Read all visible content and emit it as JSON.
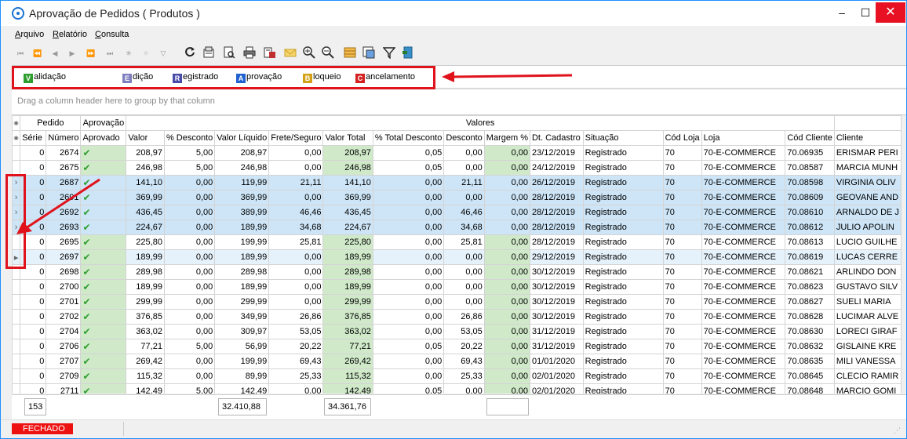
{
  "window": {
    "title": "Aprovação de Pedidos ( Produtos )",
    "min": "–",
    "max": "☐",
    "close": "✕"
  },
  "menu": [
    {
      "u": "A",
      "rest": "rquivo"
    },
    {
      "u": "R",
      "rest": "elatório"
    },
    {
      "u": "C",
      "rest": "onsulta"
    }
  ],
  "toolbar": {
    "nav": [
      "⏮",
      "⏪",
      "◀",
      "▶",
      "⏩",
      "⏭",
      "✳",
      "✳",
      "▽"
    ],
    "icons": [
      "refresh-icon",
      "properties-icon",
      "preview-icon",
      "print-icon",
      "export-icon",
      "email-icon",
      "zoom-in-icon",
      "zoom-out-icon",
      "columns-icon",
      "layout-icon",
      "filter-icon",
      "exit-icon"
    ]
  },
  "legend": [
    {
      "letter": "V",
      "rest": "alidação",
      "color": "#2e9e2e"
    },
    {
      "letter": "E",
      "rest": "dição",
      "color": "#8080c0"
    },
    {
      "letter": "R",
      "rest": "egistrado",
      "color": "#4a4aa8"
    },
    {
      "letter": "A",
      "rest": "provação",
      "color": "#2060d0"
    },
    {
      "letter": "B",
      "rest": "loqueio",
      "color": "#d4a017"
    },
    {
      "letter": "C",
      "rest": "ancelamento",
      "color": "#d42020"
    }
  ],
  "group_hint": "Drag a column header here to group by that column",
  "band_headers": {
    "pedido": "Pedido",
    "aprovacao": "Aprovação",
    "valores": "Valores"
  },
  "columns": [
    "Série",
    "Número",
    "Aprovado",
    "Valor",
    "% Desconto",
    "Valor Líquido",
    "Frete/Seguro",
    "Valor Total",
    "% Total Desconto",
    "Desconto",
    "Margem %",
    "Dt. Cadastro",
    "Situação",
    "Cód Loja",
    "Loja",
    "Cód Cliente",
    "Cliente"
  ],
  "rows": [
    {
      "serie": "0",
      "numero": "2674",
      "valor": "208,97",
      "pdesc": "5,00",
      "vliq": "208,97",
      "frete": "0,00",
      "vtotal": "208,97",
      "ptdesc": "0,05",
      "desc": "0,00",
      "margem": "0,00",
      "dt": "23/12/2019",
      "sit": "Registrado",
      "codloja": "70",
      "loja": "70-E-COMMERCE",
      "codcli": "70.06935",
      "cli": "ERISMAR PERI",
      "state": ""
    },
    {
      "serie": "0",
      "numero": "2675",
      "valor": "246,98",
      "pdesc": "5,00",
      "vliq": "246,98",
      "frete": "0,00",
      "vtotal": "246,98",
      "ptdesc": "0,05",
      "desc": "0,00",
      "margem": "0,00",
      "dt": "24/12/2019",
      "sit": "Registrado",
      "codloja": "70",
      "loja": "70-E-COMMERCE",
      "codcli": "70.08587",
      "cli": "MARCIA MUNH",
      "state": ""
    },
    {
      "serie": "0",
      "numero": "2687",
      "valor": "141,10",
      "pdesc": "0,00",
      "vliq": "119,99",
      "frete": "21,11",
      "vtotal": "141,10",
      "ptdesc": "0,00",
      "desc": "21,11",
      "margem": "0,00",
      "dt": "26/12/2019",
      "sit": "Registrado",
      "codloja": "70",
      "loja": "70-E-COMMERCE",
      "codcli": "70.08598",
      "cli": "VIRGINIA OLIV",
      "state": "sel"
    },
    {
      "serie": "0",
      "numero": "2691",
      "valor": "369,99",
      "pdesc": "0,00",
      "vliq": "369,99",
      "frete": "0,00",
      "vtotal": "369,99",
      "ptdesc": "0,00",
      "desc": "0,00",
      "margem": "0,00",
      "dt": "28/12/2019",
      "sit": "Registrado",
      "codloja": "70",
      "loja": "70-E-COMMERCE",
      "codcli": "70.08609",
      "cli": "GEOVANE AND",
      "state": "sel"
    },
    {
      "serie": "0",
      "numero": "2692",
      "valor": "436,45",
      "pdesc": "0,00",
      "vliq": "389,99",
      "frete": "46,46",
      "vtotal": "436,45",
      "ptdesc": "0,00",
      "desc": "46,46",
      "margem": "0,00",
      "dt": "28/12/2019",
      "sit": "Registrado",
      "codloja": "70",
      "loja": "70-E-COMMERCE",
      "codcli": "70.08610",
      "cli": "ARNALDO DE J",
      "state": "sel"
    },
    {
      "serie": "0",
      "numero": "2693",
      "valor": "224,67",
      "pdesc": "0,00",
      "vliq": "189,99",
      "frete": "34,68",
      "vtotal": "224,67",
      "ptdesc": "0,00",
      "desc": "34,68",
      "margem": "0,00",
      "dt": "28/12/2019",
      "sit": "Registrado",
      "codloja": "70",
      "loja": "70-E-COMMERCE",
      "codcli": "70.08612",
      "cli": "JULIO APOLIN",
      "state": "sel"
    },
    {
      "serie": "0",
      "numero": "2695",
      "valor": "225,80",
      "pdesc": "0,00",
      "vliq": "199,99",
      "frete": "25,81",
      "vtotal": "225,80",
      "ptdesc": "0,00",
      "desc": "25,81",
      "margem": "0,00",
      "dt": "28/12/2019",
      "sit": "Registrado",
      "codloja": "70",
      "loja": "70-E-COMMERCE",
      "codcli": "70.08613",
      "cli": "LUCIO GUILHE",
      "state": ""
    },
    {
      "serie": "0",
      "numero": "2697",
      "valor": "189,99",
      "pdesc": "0,00",
      "vliq": "189,99",
      "frete": "0,00",
      "vtotal": "189,99",
      "ptdesc": "0,00",
      "desc": "0,00",
      "margem": "0,00",
      "dt": "29/12/2019",
      "sit": "Registrado",
      "codloja": "70",
      "loja": "70-E-COMMERCE",
      "codcli": "70.08619",
      "cli": "LUCAS CERRE",
      "state": "cur"
    },
    {
      "serie": "0",
      "numero": "2698",
      "valor": "289,98",
      "pdesc": "0,00",
      "vliq": "289,98",
      "frete": "0,00",
      "vtotal": "289,98",
      "ptdesc": "0,00",
      "desc": "0,00",
      "margem": "0,00",
      "dt": "30/12/2019",
      "sit": "Registrado",
      "codloja": "70",
      "loja": "70-E-COMMERCE",
      "codcli": "70.08621",
      "cli": "ARLINDO DON",
      "state": ""
    },
    {
      "serie": "0",
      "numero": "2700",
      "valor": "189,99",
      "pdesc": "0,00",
      "vliq": "189,99",
      "frete": "0,00",
      "vtotal": "189,99",
      "ptdesc": "0,00",
      "desc": "0,00",
      "margem": "0,00",
      "dt": "30/12/2019",
      "sit": "Registrado",
      "codloja": "70",
      "loja": "70-E-COMMERCE",
      "codcli": "70.08623",
      "cli": "GUSTAVO SILV",
      "state": ""
    },
    {
      "serie": "0",
      "numero": "2701",
      "valor": "299,99",
      "pdesc": "0,00",
      "vliq": "299,99",
      "frete": "0,00",
      "vtotal": "299,99",
      "ptdesc": "0,00",
      "desc": "0,00",
      "margem": "0,00",
      "dt": "30/12/2019",
      "sit": "Registrado",
      "codloja": "70",
      "loja": "70-E-COMMERCE",
      "codcli": "70.08627",
      "cli": "SUELI MARIA",
      "state": ""
    },
    {
      "serie": "0",
      "numero": "2702",
      "valor": "376,85",
      "pdesc": "0,00",
      "vliq": "349,99",
      "frete": "26,86",
      "vtotal": "376,85",
      "ptdesc": "0,00",
      "desc": "26,86",
      "margem": "0,00",
      "dt": "30/12/2019",
      "sit": "Registrado",
      "codloja": "70",
      "loja": "70-E-COMMERCE",
      "codcli": "70.08628",
      "cli": "LUCIMAR ALVE",
      "state": ""
    },
    {
      "serie": "0",
      "numero": "2704",
      "valor": "363,02",
      "pdesc": "0,00",
      "vliq": "309,97",
      "frete": "53,05",
      "vtotal": "363,02",
      "ptdesc": "0,00",
      "desc": "53,05",
      "margem": "0,00",
      "dt": "31/12/2019",
      "sit": "Registrado",
      "codloja": "70",
      "loja": "70-E-COMMERCE",
      "codcli": "70.08630",
      "cli": "LORECI GIRAF",
      "state": ""
    },
    {
      "serie": "0",
      "numero": "2706",
      "valor": "77,21",
      "pdesc": "5,00",
      "vliq": "56,99",
      "frete": "20,22",
      "vtotal": "77,21",
      "ptdesc": "0,05",
      "desc": "20,22",
      "margem": "0,00",
      "dt": "31/12/2019",
      "sit": "Registrado",
      "codloja": "70",
      "loja": "70-E-COMMERCE",
      "codcli": "70.08632",
      "cli": "GISLAINE KRE",
      "state": ""
    },
    {
      "serie": "0",
      "numero": "2707",
      "valor": "269,42",
      "pdesc": "0,00",
      "vliq": "199,99",
      "frete": "69,43",
      "vtotal": "269,42",
      "ptdesc": "0,00",
      "desc": "69,43",
      "margem": "0,00",
      "dt": "01/01/2020",
      "sit": "Registrado",
      "codloja": "70",
      "loja": "70-E-COMMERCE",
      "codcli": "70.08635",
      "cli": "MILI VANESSA",
      "state": ""
    },
    {
      "serie": "0",
      "numero": "2709",
      "valor": "115,32",
      "pdesc": "0,00",
      "vliq": "89,99",
      "frete": "25,33",
      "vtotal": "115,32",
      "ptdesc": "0,00",
      "desc": "25,33",
      "margem": "0,00",
      "dt": "02/01/2020",
      "sit": "Registrado",
      "codloja": "70",
      "loja": "70-E-COMMERCE",
      "codcli": "70.08645",
      "cli": "CLECIO RAMIR",
      "state": ""
    },
    {
      "serie": "0",
      "numero": "2711",
      "valor": "142,49",
      "pdesc": "5,00",
      "vliq": "142,49",
      "frete": "0,00",
      "vtotal": "142,49",
      "ptdesc": "0,05",
      "desc": "0,00",
      "margem": "0,00",
      "dt": "02/01/2020",
      "sit": "Registrado",
      "codloja": "70",
      "loja": "70-E-COMMERCE",
      "codcli": "70.08648",
      "cli": "MARCIO GOMI",
      "state": ""
    }
  ],
  "footer": {
    "count": "153",
    "sum_liquido": "32.410,88",
    "sum_total": "34.361,76",
    "margin_box": ""
  },
  "status": {
    "text": "FECHADO"
  }
}
